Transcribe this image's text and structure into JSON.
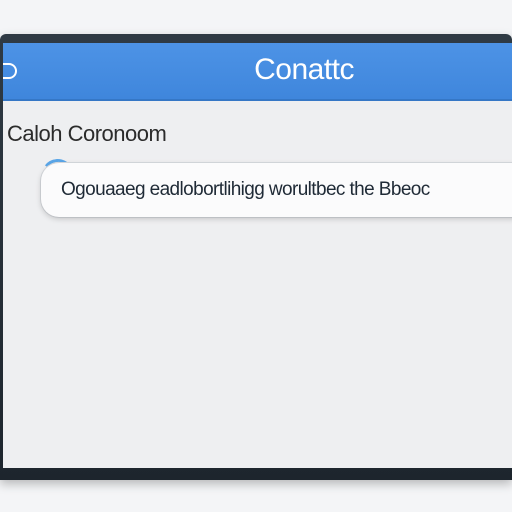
{
  "header": {
    "title": "Conattc"
  },
  "section": {
    "label": "Caloh Coronoom"
  },
  "message_field": {
    "value": "Ogouaaeg eadlobortlihigg worultbec the Bbeoc"
  },
  "colors": {
    "header_blue": "#4d93e6",
    "frame_dark": "#1d252d",
    "screen_bg": "#eeeff1",
    "focus_ring": "#5aa6e8"
  }
}
